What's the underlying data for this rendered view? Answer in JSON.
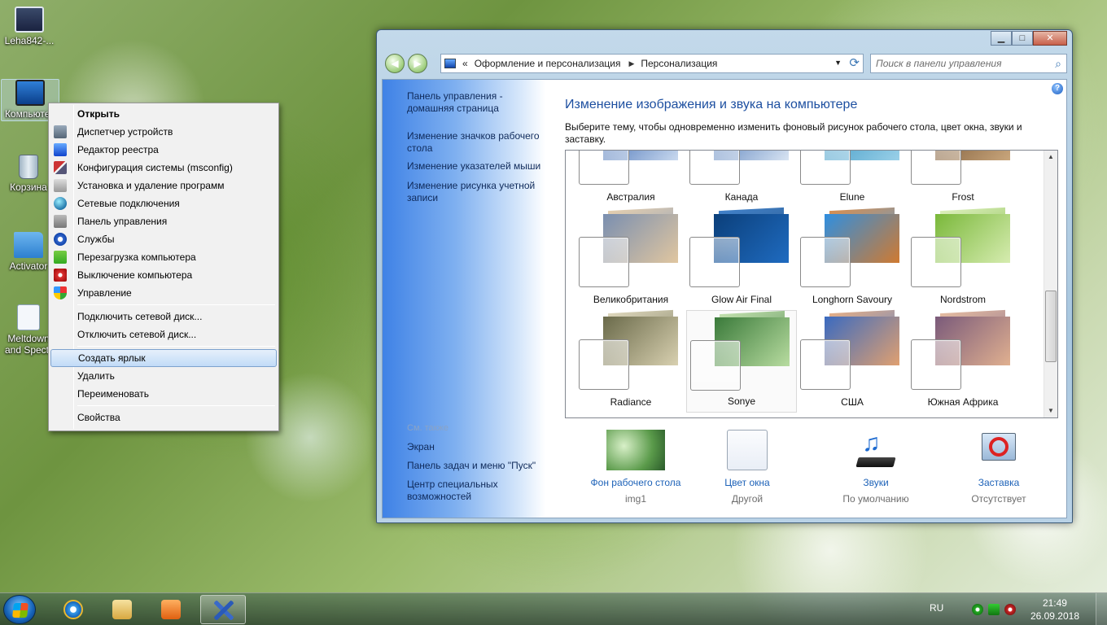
{
  "desktop": {
    "icons": [
      {
        "label": "Leha842-..."
      },
      {
        "label": "Компьютер"
      },
      {
        "label": "Корзина"
      },
      {
        "label": "Activator"
      },
      {
        "label": "Meltdown and Spectr"
      }
    ]
  },
  "context_menu": {
    "groups": [
      [
        "Открыть",
        "Диспетчер устройств",
        "Редактор реестра",
        "Конфигурация системы (msconfig)",
        "Установка и удаление программ",
        "Сетевые подключения",
        "Панель управления",
        "Службы",
        "Перезагрузка компьютера",
        "Выключение компьютера",
        "Управление"
      ],
      [
        "Подключить сетевой диск...",
        "Отключить сетевой диск..."
      ],
      [
        "Создать ярлык",
        "Удалить",
        "Переименовать"
      ],
      [
        "Свойства"
      ]
    ],
    "highlighted": "Создать ярлык"
  },
  "window": {
    "breadcrumb": {
      "prefix": "«",
      "items": [
        "Оформление и персонализация",
        "Персонализация"
      ]
    },
    "search_placeholder": "Поиск в панели управления",
    "left_links": [
      "Панель управления - домашняя страница",
      "Изменение значков рабочего стола",
      "Изменение указателей мыши",
      "Изменение рисунка учетной записи"
    ],
    "see_also_header": "См. также",
    "see_also_links": [
      "Экран",
      "Панель задач и меню \"Пуск\"",
      "Центр специальных возможностей"
    ],
    "title": "Изменение изображения и звука на компьютере",
    "description": "Выберите тему, чтобы одновременно изменить фоновый рисунок рабочего стола, цвет окна, звуки и заставку.",
    "themes": [
      {
        "name": "Австралия",
        "colors": [
          "#2a5aa8",
          "#c9d9ef"
        ]
      },
      {
        "name": "Канада",
        "colors": [
          "#3c6ab0",
          "#d8e4f2"
        ]
      },
      {
        "name": "Elune",
        "colors": [
          "#2e8fbf",
          "#9ad0e8"
        ]
      },
      {
        "name": "Frost",
        "colors": [
          "#6b4a2a",
          "#c9a67c"
        ]
      },
      {
        "name": "Великобритания",
        "colors": [
          "#7a8fb0",
          "#e0c6a0"
        ]
      },
      {
        "name": "Glow Air Final",
        "colors": [
          "#0b3f7a",
          "#1f6bc0"
        ]
      },
      {
        "name": "Longhorn Savoury",
        "colors": [
          "#2f8fe0",
          "#d07a30"
        ]
      },
      {
        "name": "Nordstrom",
        "colors": [
          "#7ab83a",
          "#d6ecb0"
        ]
      },
      {
        "name": "Radiance",
        "colors": [
          "#6a6a4a",
          "#d8d0b0"
        ]
      },
      {
        "name": "Sonye",
        "colors": [
          "#3a7a3a",
          "#b8dca0"
        ]
      },
      {
        "name": "США",
        "colors": [
          "#3a6ac0",
          "#e0a070"
        ]
      },
      {
        "name": "Южная Африка",
        "colors": [
          "#7a5a7a",
          "#e0b090"
        ]
      }
    ],
    "selected_theme": "Sonye",
    "bottom": [
      {
        "link": "Фон рабочего стола",
        "sub": "img1"
      },
      {
        "link": "Цвет окна",
        "sub": "Другой"
      },
      {
        "link": "Звуки",
        "sub": "По умолчанию"
      },
      {
        "link": "Заставка",
        "sub": "Отсутствует"
      }
    ]
  },
  "taskbar": {
    "buttons": [
      "internet-explorer",
      "explorer",
      "media-player",
      "personalization"
    ],
    "language": "RU",
    "time": "21:49",
    "date": "26.09.2018"
  }
}
